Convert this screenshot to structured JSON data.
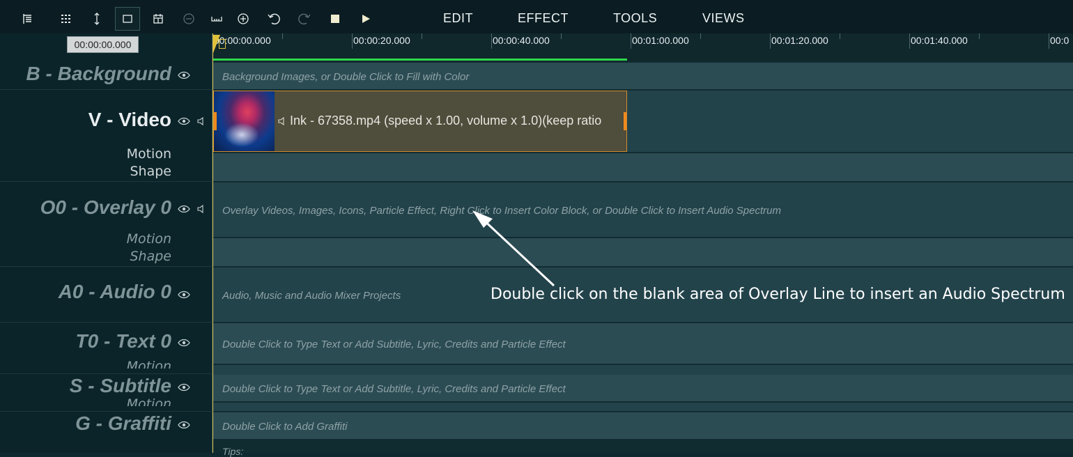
{
  "toolbar": {
    "icons": [
      "track-list-icon",
      "grid-icon",
      "vertical-resize-icon",
      "select-rect-icon",
      "calendar-icon",
      "zoom-out-icon",
      "fit-icon",
      "zoom-in-icon",
      "undo-icon",
      "redo-icon",
      "stop-icon",
      "play-icon"
    ],
    "menus": [
      "EDIT",
      "EFFECT",
      "TOOLS",
      "VIEWS"
    ]
  },
  "timecode": "00:00:00.000",
  "ruler": {
    "ticks": [
      "00:00:00.000",
      "00:00:20.000",
      "00:00:40.000",
      "00:01:00.000",
      "00:01:20.000",
      "00:01:40.000",
      "00:0"
    ]
  },
  "tracks": {
    "background": {
      "name": "B - Background",
      "hint": "Background Images, or Double Click to Fill with Color"
    },
    "video": {
      "name": "V - Video",
      "sub1": "Motion",
      "sub2": "Shape"
    },
    "overlay": {
      "name": "O0 - Overlay 0",
      "sub1": "Motion",
      "sub2": "Shape",
      "hint": "Overlay Videos, Images, Icons, Particle Effect, Right Click to Insert Color Block, or Double Click to Insert Audio Spectrum"
    },
    "audio": {
      "name": "A0 - Audio 0",
      "hint": "Audio, Music and Audio Mixer Projects"
    },
    "text": {
      "name": "T0 - Text 0",
      "sub1": "Motion",
      "hint": "Double Click to Type Text or Add Subtitle, Lyric, Credits and Particle Effect"
    },
    "subtitle": {
      "name": "S - Subtitle",
      "sub1": "Motion",
      "hint": "Double Click to Type Text or Add Subtitle, Lyric, Credits and Particle Effect"
    },
    "graffiti": {
      "name": "G - Graffiti",
      "hint": "Double Click to Add Graffiti"
    },
    "tips": "Tips:"
  },
  "clip": {
    "label": "Ink - 67358.mp4  (speed x 1.00, volume x 1.0)(keep ratio"
  },
  "annotation": "Double click on the blank area of Overlay Line to insert an Audio Spectrum",
  "colors": {
    "progress": "#2fd84a",
    "playhead": "#e0c13c",
    "clip_border": "#d58a2a"
  }
}
